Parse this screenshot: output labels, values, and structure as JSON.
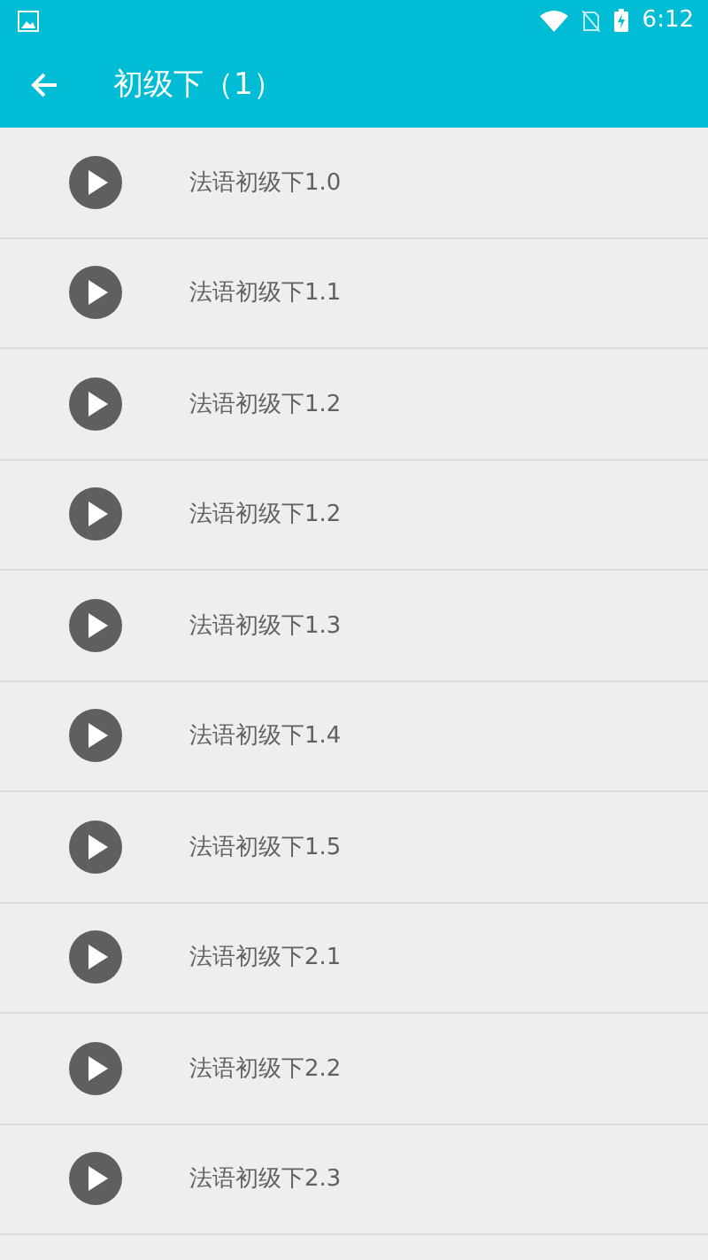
{
  "status_bar": {
    "time": "6:12"
  },
  "toolbar": {
    "title": "初级下（1）"
  },
  "items": [
    {
      "title": "法语初级下1.0"
    },
    {
      "title": "法语初级下1.1"
    },
    {
      "title": "法语初级下1.2"
    },
    {
      "title": "法语初级下1.2"
    },
    {
      "title": "法语初级下1.3"
    },
    {
      "title": "法语初级下1.4"
    },
    {
      "title": "法语初级下1.5"
    },
    {
      "title": "法语初级下2.1"
    },
    {
      "title": "法语初级下2.2"
    },
    {
      "title": "法语初级下2.3"
    }
  ]
}
